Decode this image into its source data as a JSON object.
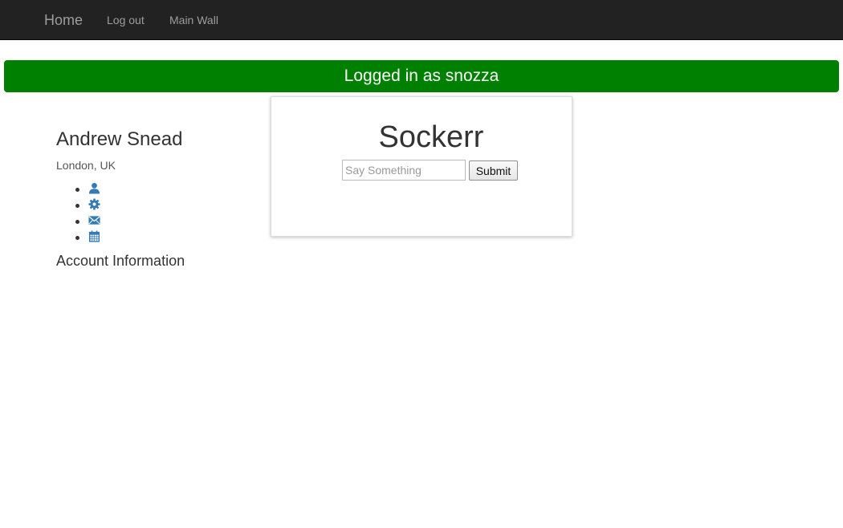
{
  "navbar": {
    "brand": "Home",
    "links": [
      "Log out",
      "Main Wall"
    ]
  },
  "alert": {
    "text": "Logged in as snozza",
    "color": "#008000"
  },
  "profile": {
    "name": "Andrew Snead",
    "location": "London, UK",
    "icons": [
      "user-icon",
      "cog-icon",
      "envelope-icon",
      "calendar-icon"
    ],
    "icon_color": "#337ab7",
    "account_heading": "Account Information"
  },
  "wall": {
    "title": "Sockerr",
    "input_placeholder": "Say Something",
    "input_value": "",
    "submit_label": "Submit"
  }
}
